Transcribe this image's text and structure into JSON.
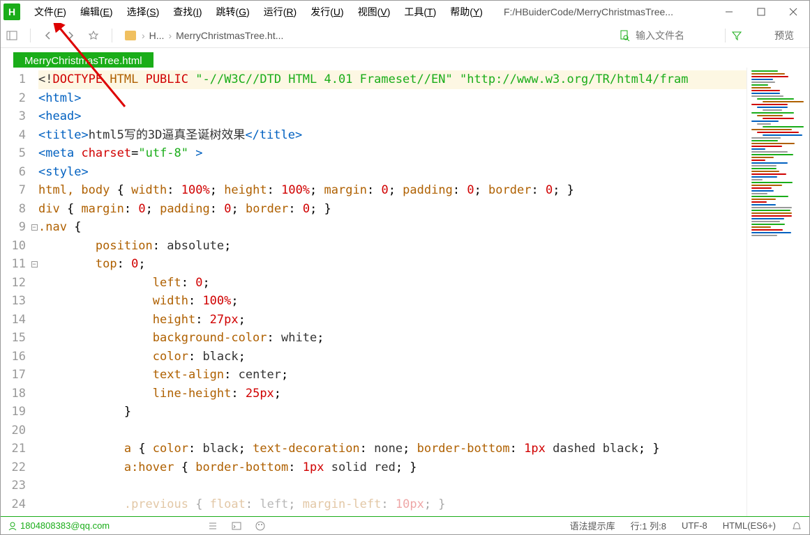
{
  "menubar": {
    "items": [
      "文件(F)",
      "编辑(E)",
      "选择(S)",
      "查找(I)",
      "跳转(G)",
      "运行(R)",
      "发行(U)",
      "视图(V)",
      "工具(T)",
      "帮助(Y)"
    ],
    "title_path": "F:/HBuiderCode/MerryChristmasTree..."
  },
  "toolbar": {
    "breadcrumb": {
      "part1": "H...",
      "part2": "MerryChristmasTree.ht..."
    },
    "search_placeholder": "输入文件名",
    "preview_label": "预览"
  },
  "tab": {
    "label": "MerryChristmasTree.html"
  },
  "code": {
    "lines_count": 24,
    "fold_markers": {
      "9": "-",
      "11": "-"
    },
    "l1": {
      "a": "<!",
      "b": "DOCTYPE ",
      "c": "HTML",
      "d": " ",
      "e": "PUBLIC",
      "f": " ",
      "g": "\"-//W3C//DTD HTML 4.01 Frameset//EN\"",
      "h": " ",
      "i": "\"http://www.w3.org/TR/html4/fram"
    },
    "l2": {
      "open": "<",
      "tag": "html",
      "close": ">"
    },
    "l3": {
      "open": "<",
      "tag": "head",
      "close": ">"
    },
    "l4": {
      "open": "<",
      "tag": "title",
      "close": ">",
      "text": "html5写的3D逼真圣诞树效果",
      "open2": "</",
      "tag2": "title",
      "close2": ">"
    },
    "l5": {
      "open": "<",
      "tag": "meta",
      "sp": " ",
      "attr": "charset",
      "eq": "=",
      "val": "\"utf-8\"",
      "sp2": " ",
      "close": ">"
    },
    "l6": {
      "open": "<",
      "tag": "style",
      "close": ">"
    },
    "l7": {
      "sel": "html, body",
      "b": " { ",
      "p1": "width",
      "c1": ": ",
      "v1": "100%",
      "s1": "; ",
      "p2": "height",
      "c2": ": ",
      "v2": "100%",
      "s2": "; ",
      "p3": "margin",
      "c3": ": ",
      "v3": "0",
      "s3": "; ",
      "p4": "padding",
      "c4": ": ",
      "v4": "0",
      "s4": "; ",
      "p5": "border",
      "c5": ": ",
      "v5": "0",
      "s5": "; }"
    },
    "l8": {
      "sel": "div",
      "b": " { ",
      "p1": "margin",
      "c1": ": ",
      "v1": "0",
      "s1": "; ",
      "p2": "padding",
      "c2": ": ",
      "v2": "0",
      "s2": "; ",
      "p3": "border",
      "c3": ": ",
      "v3": "0",
      "s3": "; }"
    },
    "l9": {
      "sel": ".nav",
      "b": " {"
    },
    "l10": {
      "i": "        ",
      "p": "position",
      "c": ": ",
      "v": "absolute",
      "s": ";"
    },
    "l11": {
      "i": "        ",
      "p": "top",
      "c": ": ",
      "v": "0",
      "s": ";"
    },
    "l12": {
      "i": "                ",
      "p": "left",
      "c": ": ",
      "v": "0",
      "s": ";"
    },
    "l13": {
      "i": "                ",
      "p": "width",
      "c": ": ",
      "v": "100%",
      "s": ";"
    },
    "l14": {
      "i": "                ",
      "p": "height",
      "c": ": ",
      "v": "27px",
      "s": ";"
    },
    "l15": {
      "i": "                ",
      "p": "background-color",
      "c": ": ",
      "v": "white",
      "s": ";"
    },
    "l16": {
      "i": "                ",
      "p": "color",
      "c": ": ",
      "v": "black",
      "s": ";"
    },
    "l17": {
      "i": "                ",
      "p": "text-align",
      "c": ": ",
      "v": "center",
      "s": ";"
    },
    "l18": {
      "i": "                ",
      "p": "line-height",
      "c": ": ",
      "v": "25px",
      "s": ";"
    },
    "l19": {
      "i": "            ",
      "b": "}"
    },
    "l21": {
      "i": "            ",
      "sel": "a",
      "b": " { ",
      "p1": "color",
      "v1": "black",
      "p2": "text-decoration",
      "v2": "none",
      "p3": "border-bottom",
      "v3a": "1px",
      "v3b": " dashed black",
      "e": "; }"
    },
    "l22": {
      "i": "            ",
      "sel": "a:hover",
      "b": " { ",
      "p": "border-bottom",
      "v1": "1px",
      "v2": " solid red",
      "e": "; }"
    },
    "l24": {
      "i": "            ",
      "sel": ".previous",
      "b": " { ",
      "p1": "float",
      "v1": "left",
      "p2": "margin-left",
      "v2": "10px",
      "e": "; }"
    }
  },
  "statusbar": {
    "user": "1804808383@qq.com",
    "syntax": "语法提示库",
    "pos": "行:1 列:8",
    "encoding": "UTF-8",
    "lang": "HTML(ES6+)"
  }
}
